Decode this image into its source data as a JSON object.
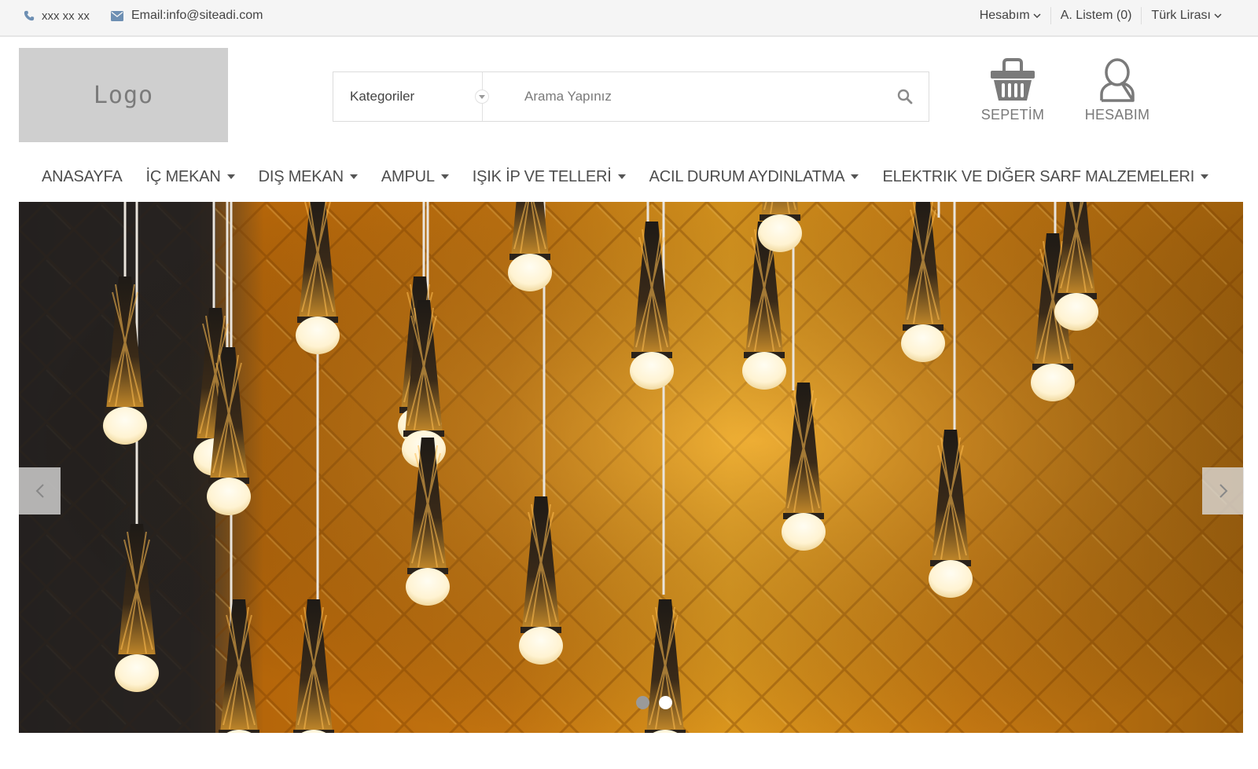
{
  "topbar": {
    "phone": "xxx xx xx",
    "email": "Email:info@siteadi.com",
    "account_label": "Hesabım",
    "wishlist_label": "A. Listem (0)",
    "currency_label": "Türk Lirası"
  },
  "header": {
    "logo_text": "Logo",
    "category_label": "Kategoriler",
    "search_placeholder": "Arama Yapınız",
    "cart_label": "SEPETİM",
    "account_label": "HESABIM"
  },
  "nav": {
    "items": [
      {
        "label": "ANASAYFA",
        "has_dropdown": false
      },
      {
        "label": "İÇ MEKAN",
        "has_dropdown": true
      },
      {
        "label": "DIŞ MEKAN",
        "has_dropdown": true
      },
      {
        "label": "AMPUL",
        "has_dropdown": true
      },
      {
        "label": "IŞIK İP VE TELLERİ",
        "has_dropdown": true
      },
      {
        "label": "ACIL DURUM AYDINLATMA",
        "has_dropdown": true
      },
      {
        "label": "ELEKTRIK VE DIĞER SARF MALZEMELERI",
        "has_dropdown": true
      }
    ]
  },
  "slider": {
    "slide_count": 2,
    "active_slide": 2
  },
  "colors": {
    "topbar_bg": "#f5f5f5",
    "icon_blue": "#6d8fb3",
    "nav_text": "#4d4d4d",
    "logo_bg": "#cfcfcf"
  }
}
